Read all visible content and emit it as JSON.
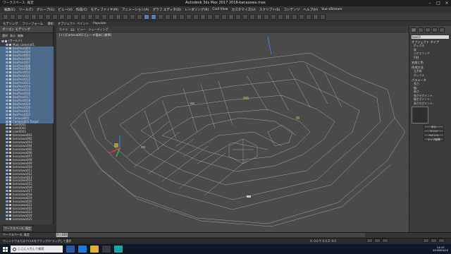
{
  "window": {
    "title": "Autodesk 3ds Max 2017    2018-kanazawa.max",
    "workspace": "ワークスペース: 既定"
  },
  "menu": [
    "編集(E)",
    "ツール(T)",
    "グループ(G)",
    "ビュー(V)",
    "作成(C)",
    "モディファイヤ(M)",
    "アニメーション(A)",
    "グラフ エディタ(D)",
    "レンダリング(R)",
    "Civil View",
    "カスタマイズ(U)",
    "スクリプト(S)",
    "コンテンツ",
    "ヘルプ(H)",
    "Vue xStream"
  ],
  "ribbon_tabs": [
    "モデリング",
    "フリーフォーム",
    "選択",
    "オブジェクト ペイント",
    "Populate"
  ],
  "left_panel": {
    "title_tabs": [
      "ポリゴン モデリング"
    ],
    "toolbar": [
      "選択",
      "表示",
      "編集"
    ],
    "items": [
      {
        "label": "(ワールド)",
        "indent": false,
        "selected": false
      },
      {
        "label": "Main camera01",
        "indent": true,
        "selected": false
      },
      {
        "label": "BoxPrest003",
        "indent": true,
        "selected": true
      },
      {
        "label": "BoxPrest004",
        "indent": true,
        "selected": true
      },
      {
        "label": "BoxPrest005",
        "indent": true,
        "selected": true
      },
      {
        "label": "BoxPrest006",
        "indent": true,
        "selected": true
      },
      {
        "label": "BoxPrest007",
        "indent": true,
        "selected": true
      },
      {
        "label": "BoxPrest008",
        "indent": true,
        "selected": true
      },
      {
        "label": "BoxPrest009",
        "indent": true,
        "selected": true
      },
      {
        "label": "BoxPrest010",
        "indent": true,
        "selected": true
      },
      {
        "label": "BoxPrest011",
        "indent": true,
        "selected": true
      },
      {
        "label": "BoxPrest012",
        "indent": true,
        "selected": true
      },
      {
        "label": "BoxPrest013",
        "indent": true,
        "selected": true
      },
      {
        "label": "BoxPrest014",
        "indent": true,
        "selected": true
      },
      {
        "label": "BoxPrest015",
        "indent": true,
        "selected": true
      },
      {
        "label": "BoxPrest016",
        "indent": true,
        "selected": true
      },
      {
        "label": "BoxPrest017",
        "indent": true,
        "selected": true
      },
      {
        "label": "BoxPrest018",
        "indent": true,
        "selected": true
      },
      {
        "label": "BoxPrest019",
        "indent": true,
        "selected": true
      },
      {
        "label": "BoxPrest020",
        "indent": true,
        "selected": true
      },
      {
        "label": "BoxPrest021",
        "indent": true,
        "selected": true
      },
      {
        "label": "BoxPrest022",
        "indent": true,
        "selected": true
      },
      {
        "label": "Camera001",
        "indent": true,
        "selected": true
      },
      {
        "label": "Camera001.Target",
        "indent": true,
        "selected": true
      },
      {
        "label": "cam0001",
        "indent": true,
        "selected": false
      },
      {
        "label": "cam0002",
        "indent": true,
        "selected": false
      },
      {
        "label": "cam0003",
        "indent": true,
        "selected": false
      },
      {
        "label": "kanazawa001",
        "indent": true,
        "selected": false
      },
      {
        "label": "kanazawa002",
        "indent": true,
        "selected": false
      },
      {
        "label": "kanazawa003",
        "indent": true,
        "selected": false
      },
      {
        "label": "kanazawa004",
        "indent": true,
        "selected": false
      },
      {
        "label": "kanazawa005",
        "indent": true,
        "selected": false
      },
      {
        "label": "kanazawa006",
        "indent": true,
        "selected": false
      },
      {
        "label": "kanazawa007",
        "indent": true,
        "selected": false
      },
      {
        "label": "kanazawa008",
        "indent": true,
        "selected": false
      },
      {
        "label": "kanazawa009",
        "indent": true,
        "selected": false
      },
      {
        "label": "kanazawa010",
        "indent": true,
        "selected": false
      },
      {
        "label": "kanazawa011",
        "indent": true,
        "selected": false
      },
      {
        "label": "kanazawa012",
        "indent": true,
        "selected": false
      },
      {
        "label": "kanazawa013",
        "indent": true,
        "selected": false
      },
      {
        "label": "kanazawa014",
        "indent": true,
        "selected": false
      },
      {
        "label": "kanazawa015",
        "indent": true,
        "selected": false
      },
      {
        "label": "kanazawa016",
        "indent": true,
        "selected": false
      },
      {
        "label": "kanazawa017",
        "indent": true,
        "selected": false
      },
      {
        "label": "kanazawa018",
        "indent": true,
        "selected": false
      },
      {
        "label": "kanazawa019",
        "indent": true,
        "selected": false
      },
      {
        "label": "kanazawa020",
        "indent": true,
        "selected": false
      },
      {
        "label": "kanazawa021",
        "indent": true,
        "selected": false
      },
      {
        "label": "kanazawa022",
        "indent": true,
        "selected": false
      },
      {
        "label": "kanazawa023",
        "indent": true,
        "selected": false
      },
      {
        "label": "kanazawa024",
        "indent": true,
        "selected": false
      },
      {
        "label": "kanazawa025",
        "indent": true,
        "selected": false
      }
    ],
    "footer": "ワークスペース: 既定"
  },
  "viewport": {
    "label": "[+] [Camera001] [シーデ基本] [標準]",
    "tabs": [
      "カメラ",
      "2D",
      "ビュー",
      "シェーディング"
    ]
  },
  "right_panel": {
    "name_field": "box01",
    "sections": [
      {
        "title": "オブジェクト タイプ",
        "lines": [
          "ボックス",
          "球",
          "ジオスフィア",
          "円柱"
        ]
      },
      {
        "title": "名前と色",
        "lines": []
      },
      {
        "title": "作成方法",
        "lines": [
          "立方体",
          "ボックス"
        ]
      },
      {
        "title": "パラメータ",
        "lines": [
          "長さ:",
          "幅:",
          "高さ:",
          "長さセグメント:",
          "幅セグメント:",
          "高さセグメント:"
        ]
      }
    ],
    "buttons": [
      "中心",
      "エッジ",
      "ペイント",
      "マップ座標"
    ]
  },
  "timeline": {
    "label": "ワークスペース: 既定",
    "frame": "0 / 100"
  },
  "status": {
    "message": "ウィンドウまたはクロスをクリック/ドラッグして選択",
    "coords": "X: 0.0  Y: 0.0  Z: 0.0",
    "grid": "グリッド = 10.0"
  },
  "taskbar": {
    "search_placeholder": "ここに入力して検索",
    "time": "14:10",
    "date": "2018/04/20"
  }
}
